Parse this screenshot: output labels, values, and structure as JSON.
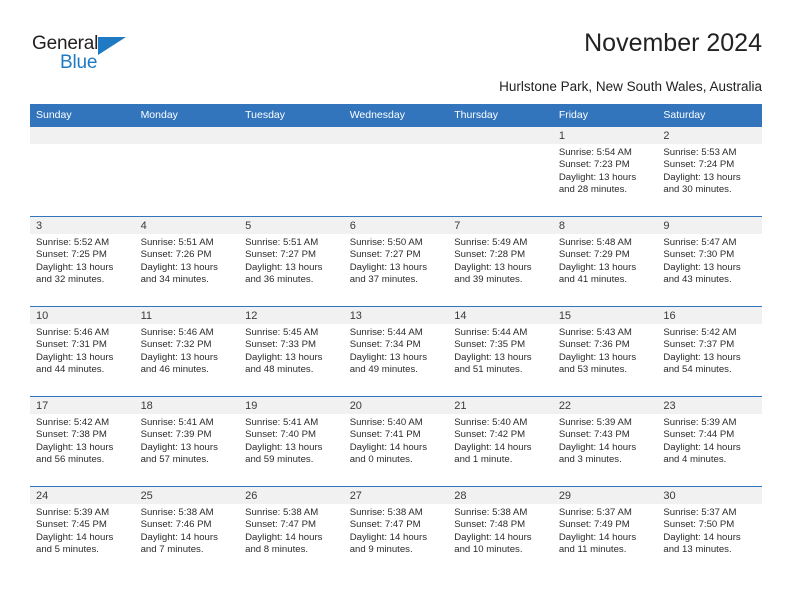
{
  "brand": {
    "name_top": "General",
    "name_bottom": "Blue",
    "accent_color": "#1f7ac4"
  },
  "header": {
    "title": "November 2024",
    "location": "Hurlstone Park, New South Wales, Australia"
  },
  "theme": {
    "header_row_bg": "#3275bd",
    "daynum_bg": "#f1f1f1",
    "grid_line": "#3275bd"
  },
  "weekday_headers": [
    "Sunday",
    "Monday",
    "Tuesday",
    "Wednesday",
    "Thursday",
    "Friday",
    "Saturday"
  ],
  "weeks": [
    [
      {
        "day": "",
        "empty": true
      },
      {
        "day": "",
        "empty": true
      },
      {
        "day": "",
        "empty": true
      },
      {
        "day": "",
        "empty": true
      },
      {
        "day": "",
        "empty": true
      },
      {
        "day": "1",
        "sunrise": "Sunrise: 5:54 AM",
        "sunset": "Sunset: 7:23 PM",
        "daylight": "Daylight: 13 hours and 28 minutes."
      },
      {
        "day": "2",
        "sunrise": "Sunrise: 5:53 AM",
        "sunset": "Sunset: 7:24 PM",
        "daylight": "Daylight: 13 hours and 30 minutes."
      }
    ],
    [
      {
        "day": "3",
        "sunrise": "Sunrise: 5:52 AM",
        "sunset": "Sunset: 7:25 PM",
        "daylight": "Daylight: 13 hours and 32 minutes."
      },
      {
        "day": "4",
        "sunrise": "Sunrise: 5:51 AM",
        "sunset": "Sunset: 7:26 PM",
        "daylight": "Daylight: 13 hours and 34 minutes."
      },
      {
        "day": "5",
        "sunrise": "Sunrise: 5:51 AM",
        "sunset": "Sunset: 7:27 PM",
        "daylight": "Daylight: 13 hours and 36 minutes."
      },
      {
        "day": "6",
        "sunrise": "Sunrise: 5:50 AM",
        "sunset": "Sunset: 7:27 PM",
        "daylight": "Daylight: 13 hours and 37 minutes."
      },
      {
        "day": "7",
        "sunrise": "Sunrise: 5:49 AM",
        "sunset": "Sunset: 7:28 PM",
        "daylight": "Daylight: 13 hours and 39 minutes."
      },
      {
        "day": "8",
        "sunrise": "Sunrise: 5:48 AM",
        "sunset": "Sunset: 7:29 PM",
        "daylight": "Daylight: 13 hours and 41 minutes."
      },
      {
        "day": "9",
        "sunrise": "Sunrise: 5:47 AM",
        "sunset": "Sunset: 7:30 PM",
        "daylight": "Daylight: 13 hours and 43 minutes."
      }
    ],
    [
      {
        "day": "10",
        "sunrise": "Sunrise: 5:46 AM",
        "sunset": "Sunset: 7:31 PM",
        "daylight": "Daylight: 13 hours and 44 minutes."
      },
      {
        "day": "11",
        "sunrise": "Sunrise: 5:46 AM",
        "sunset": "Sunset: 7:32 PM",
        "daylight": "Daylight: 13 hours and 46 minutes."
      },
      {
        "day": "12",
        "sunrise": "Sunrise: 5:45 AM",
        "sunset": "Sunset: 7:33 PM",
        "daylight": "Daylight: 13 hours and 48 minutes."
      },
      {
        "day": "13",
        "sunrise": "Sunrise: 5:44 AM",
        "sunset": "Sunset: 7:34 PM",
        "daylight": "Daylight: 13 hours and 49 minutes."
      },
      {
        "day": "14",
        "sunrise": "Sunrise: 5:44 AM",
        "sunset": "Sunset: 7:35 PM",
        "daylight": "Daylight: 13 hours and 51 minutes."
      },
      {
        "day": "15",
        "sunrise": "Sunrise: 5:43 AM",
        "sunset": "Sunset: 7:36 PM",
        "daylight": "Daylight: 13 hours and 53 minutes."
      },
      {
        "day": "16",
        "sunrise": "Sunrise: 5:42 AM",
        "sunset": "Sunset: 7:37 PM",
        "daylight": "Daylight: 13 hours and 54 minutes."
      }
    ],
    [
      {
        "day": "17",
        "sunrise": "Sunrise: 5:42 AM",
        "sunset": "Sunset: 7:38 PM",
        "daylight": "Daylight: 13 hours and 56 minutes."
      },
      {
        "day": "18",
        "sunrise": "Sunrise: 5:41 AM",
        "sunset": "Sunset: 7:39 PM",
        "daylight": "Daylight: 13 hours and 57 minutes."
      },
      {
        "day": "19",
        "sunrise": "Sunrise: 5:41 AM",
        "sunset": "Sunset: 7:40 PM",
        "daylight": "Daylight: 13 hours and 59 minutes."
      },
      {
        "day": "20",
        "sunrise": "Sunrise: 5:40 AM",
        "sunset": "Sunset: 7:41 PM",
        "daylight": "Daylight: 14 hours and 0 minutes."
      },
      {
        "day": "21",
        "sunrise": "Sunrise: 5:40 AM",
        "sunset": "Sunset: 7:42 PM",
        "daylight": "Daylight: 14 hours and 1 minute."
      },
      {
        "day": "22",
        "sunrise": "Sunrise: 5:39 AM",
        "sunset": "Sunset: 7:43 PM",
        "daylight": "Daylight: 14 hours and 3 minutes."
      },
      {
        "day": "23",
        "sunrise": "Sunrise: 5:39 AM",
        "sunset": "Sunset: 7:44 PM",
        "daylight": "Daylight: 14 hours and 4 minutes."
      }
    ],
    [
      {
        "day": "24",
        "sunrise": "Sunrise: 5:39 AM",
        "sunset": "Sunset: 7:45 PM",
        "daylight": "Daylight: 14 hours and 5 minutes."
      },
      {
        "day": "25",
        "sunrise": "Sunrise: 5:38 AM",
        "sunset": "Sunset: 7:46 PM",
        "daylight": "Daylight: 14 hours and 7 minutes."
      },
      {
        "day": "26",
        "sunrise": "Sunrise: 5:38 AM",
        "sunset": "Sunset: 7:47 PM",
        "daylight": "Daylight: 14 hours and 8 minutes."
      },
      {
        "day": "27",
        "sunrise": "Sunrise: 5:38 AM",
        "sunset": "Sunset: 7:47 PM",
        "daylight": "Daylight: 14 hours and 9 minutes."
      },
      {
        "day": "28",
        "sunrise": "Sunrise: 5:38 AM",
        "sunset": "Sunset: 7:48 PM",
        "daylight": "Daylight: 14 hours and 10 minutes."
      },
      {
        "day": "29",
        "sunrise": "Sunrise: 5:37 AM",
        "sunset": "Sunset: 7:49 PM",
        "daylight": "Daylight: 14 hours and 11 minutes."
      },
      {
        "day": "30",
        "sunrise": "Sunrise: 5:37 AM",
        "sunset": "Sunset: 7:50 PM",
        "daylight": "Daylight: 14 hours and 13 minutes."
      }
    ]
  ]
}
